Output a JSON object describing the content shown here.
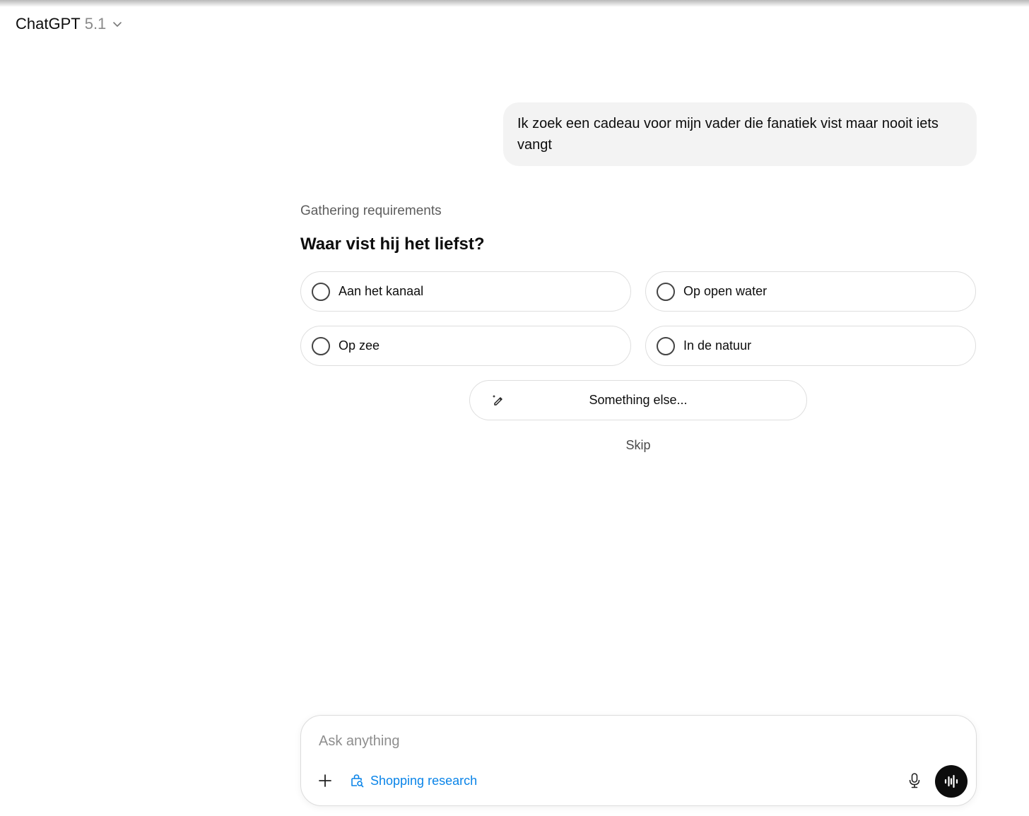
{
  "header": {
    "model_name": "ChatGPT",
    "model_version": "5.1",
    "chevron_icon": "chevron-down-icon"
  },
  "conversation": {
    "user_message": "Ik zoek een cadeau voor mijn vader die fanatiek vist maar nooit iets vangt"
  },
  "assistant": {
    "status": "Gathering requirements",
    "question": "Waar vist hij het liefst?",
    "options": [
      {
        "label": "Aan het kanaal"
      },
      {
        "label": "Op open water"
      },
      {
        "label": "Op zee"
      },
      {
        "label": "In de natuur"
      }
    ],
    "something_else_label": "Something else...",
    "something_else_icon": "pencil-icon",
    "skip_label": "Skip"
  },
  "composer": {
    "placeholder": "Ask anything",
    "shopping_label": "Shopping research",
    "shopping_color": "#0a84e8",
    "icons": [
      "plus-icon",
      "shopping-bag-search-icon",
      "microphone-icon",
      "voice-waveform-icon"
    ]
  }
}
